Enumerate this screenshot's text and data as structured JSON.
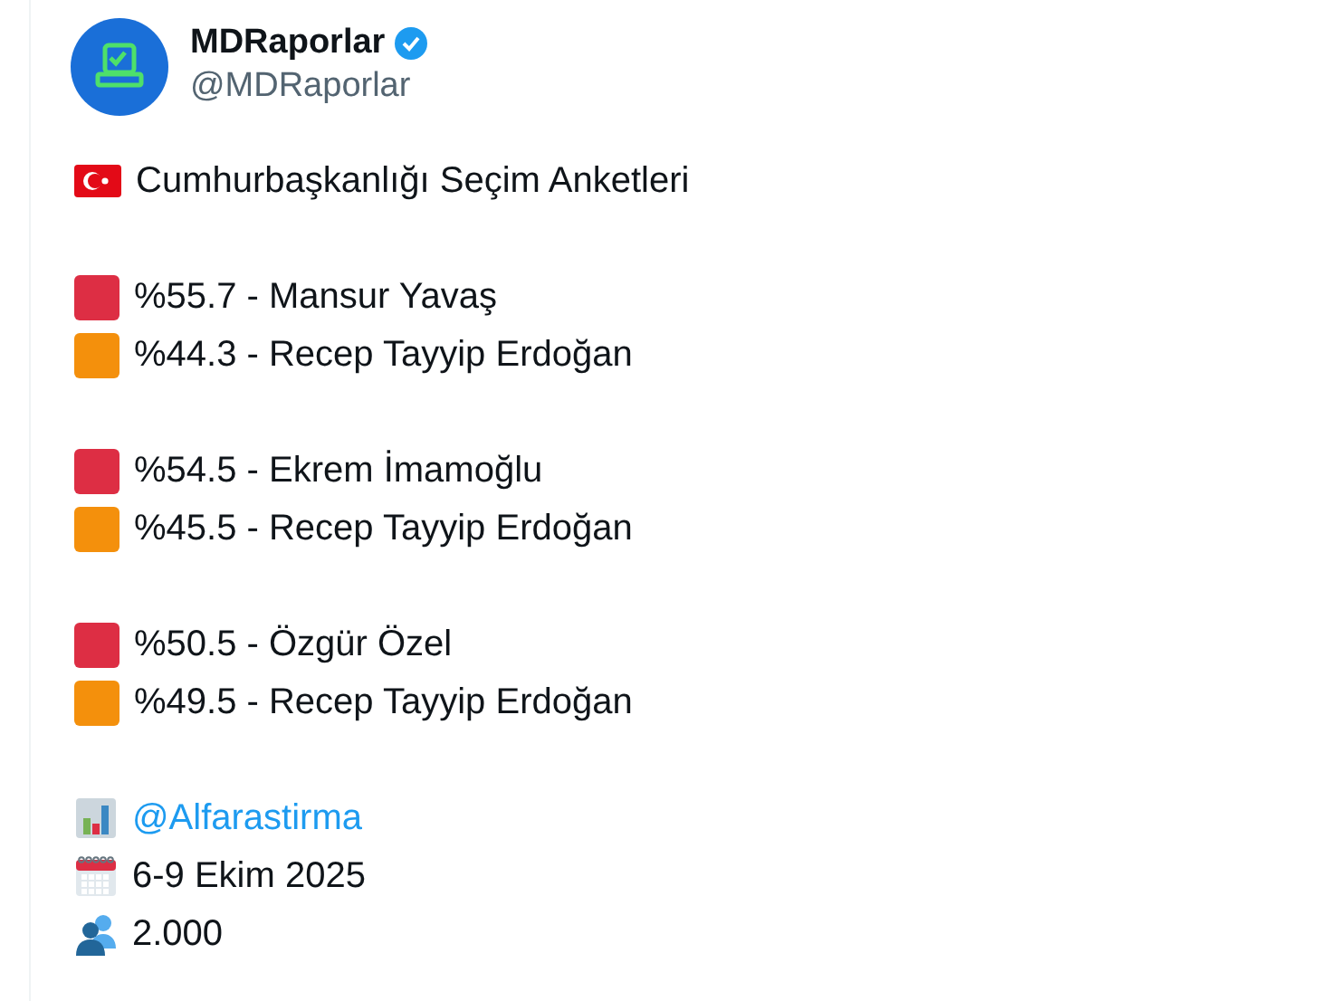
{
  "author": {
    "name": "MDRaporlar",
    "handle": "@MDRaporlar",
    "verified": true
  },
  "title": "Cumhurbaşkanlığı Seçim Anketleri",
  "groups": [
    {
      "results": [
        {
          "text": "%55.7 - Mansur Yavaş",
          "color": "#dd2e44"
        },
        {
          "text": "%44.3 - Recep Tayyip Erdoğan",
          "color": "#f4900c"
        }
      ]
    },
    {
      "results": [
        {
          "text": "%54.5 - Ekrem İmamoğlu",
          "color": "#dd2e44"
        },
        {
          "text": "%45.5 - Recep Tayyip Erdoğan",
          "color": "#f4900c"
        }
      ]
    },
    {
      "results": [
        {
          "text": "%50.5 - Özgür Özel",
          "color": "#dd2e44"
        },
        {
          "text": "%49.5 - Recep Tayyip Erdoğan",
          "color": "#f4900c"
        }
      ]
    }
  ],
  "footer": [
    {
      "kind": "source",
      "text": "@Alfarastirma"
    },
    {
      "kind": "date",
      "text": "6-9 Ekim 2025"
    },
    {
      "kind": "sample",
      "text": "2.000"
    }
  ]
}
